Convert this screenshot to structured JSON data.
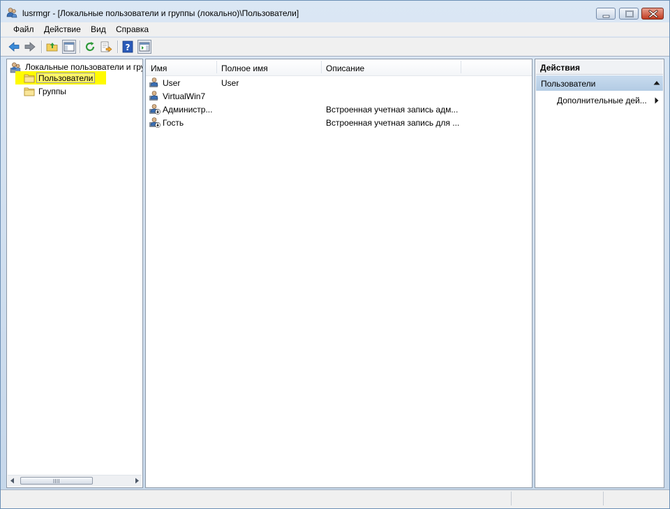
{
  "window": {
    "title": "lusrmgr - [Локальные пользователи и группы (локально)\\Пользователи]",
    "controls": [
      "minimize-button",
      "maximize-button",
      "close-button"
    ]
  },
  "menu": {
    "items": [
      {
        "label": "Файл"
      },
      {
        "label": "Действие"
      },
      {
        "label": "Вид"
      },
      {
        "label": "Справка"
      }
    ]
  },
  "toolbar": {
    "icons": [
      "back-arrow-icon",
      "forward-arrow-icon",
      "up-folder-icon",
      "show-hide-tree-icon",
      "refresh-icon",
      "export-list-icon",
      "help-icon",
      "show-hide-action-pane-icon"
    ]
  },
  "tree": {
    "root_label": "Локальные пользователи и гру",
    "items": [
      {
        "label": "Пользователи",
        "selected": true
      },
      {
        "label": "Группы",
        "selected": false
      }
    ],
    "highlight_color": "#fffa00"
  },
  "list": {
    "columns": [
      "Имя",
      "Полное имя",
      "Описание"
    ],
    "rows": [
      {
        "name": "User",
        "full_name": "User",
        "description": "",
        "icon": "user-icon"
      },
      {
        "name": "VirtualWin7",
        "full_name": "",
        "description": "",
        "icon": "user-icon"
      },
      {
        "name": "Администр...",
        "full_name": "",
        "description": "Встроенная учетная запись адм...",
        "icon": "disabled-user-icon"
      },
      {
        "name": "Гость",
        "full_name": "",
        "description": "Встроенная учетная запись для ...",
        "icon": "disabled-user-icon"
      }
    ]
  },
  "actions": {
    "title": "Действия",
    "section": "Пользователи",
    "item": "Дополнительные дей..."
  },
  "colors": {
    "accent": "#b3cbe4",
    "selection_highlight": "#fffa00",
    "close_button": "#c13b22"
  }
}
